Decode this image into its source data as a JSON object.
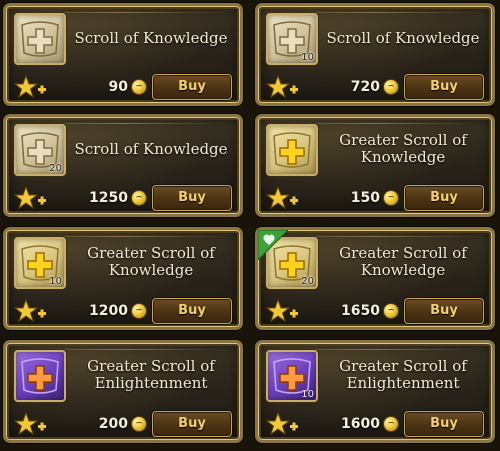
{
  "colors": {
    "frame_gold": "#8a7442",
    "buy_text": "#f3cf6a",
    "title_text": "#f3ead2",
    "coin": "#f0c93a",
    "badge_green": "#3aa33a"
  },
  "items": [
    {
      "title": "Scroll of Knowledge",
      "quantity": "",
      "price": "90",
      "buy_label": "Buy",
      "icon": "scroll-of-knowledge-icon"
    },
    {
      "title": "Scroll of Knowledge",
      "quantity": "10",
      "price": "720",
      "buy_label": "Buy",
      "icon": "scroll-of-knowledge-icon"
    },
    {
      "title": "Scroll of Knowledge",
      "quantity": "20",
      "price": "1250",
      "buy_label": "Buy",
      "icon": "scroll-of-knowledge-icon"
    },
    {
      "title": "Greater Scroll of Knowledge",
      "quantity": "",
      "price": "150",
      "buy_label": "Buy",
      "icon": "greater-scroll-of-knowledge-icon"
    },
    {
      "title": "Greater Scroll of Knowledge",
      "quantity": "10",
      "price": "1200",
      "buy_label": "Buy",
      "icon": "greater-scroll-of-knowledge-icon"
    },
    {
      "title": "Greater Scroll of Knowledge",
      "quantity": "20",
      "price": "1650",
      "buy_label": "Buy",
      "icon": "greater-scroll-of-knowledge-icon",
      "badge": "favorite-heart-icon"
    },
    {
      "title": "Greater Scroll of Enlightenment",
      "quantity": "",
      "price": "200",
      "buy_label": "Buy",
      "icon": "greater-scroll-of-enlightenment-icon"
    },
    {
      "title": "Greater Scroll of Enlightenment",
      "quantity": "10",
      "price": "1600",
      "buy_label": "Buy",
      "icon": "greater-scroll-of-enlightenment-icon"
    }
  ]
}
